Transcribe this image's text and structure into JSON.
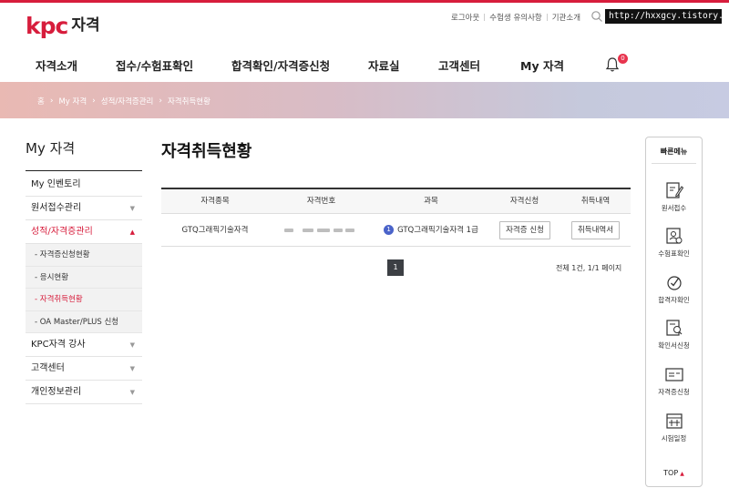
{
  "header": {
    "logo_mark": "kpc",
    "logo_text": "자격",
    "util_links": [
      "로그아웃",
      "수험생 유의사항",
      "기관소개"
    ],
    "url_overlay": "http://hxxgcy.tistory.com",
    "notification_count": "0",
    "nav": [
      "자격소개",
      "접수/수험표확인",
      "합격확인/자격증신청",
      "자료실",
      "고객센터",
      "My 자격"
    ]
  },
  "breadcrumb": [
    "홈",
    "My 자격",
    "성적/자격증관리",
    "자격취득현황"
  ],
  "sidebar": {
    "title": "My 자격",
    "items": [
      {
        "label": "My 인벤토리"
      },
      {
        "label": "원서접수관리"
      },
      {
        "label": "성적/자격증관리"
      },
      {
        "label": "KPC자격 강사"
      },
      {
        "label": "고객센터"
      },
      {
        "label": "개인정보관리"
      }
    ],
    "sub_items": [
      "- 자격증신청현황",
      "- 응시현황",
      "- 자격취득현황",
      "- OA Master/PLUS 신청"
    ]
  },
  "main": {
    "title": "자격취득현황",
    "columns": [
      "자격종목",
      "자격번호",
      "과목",
      "자격신청",
      "취득내역"
    ],
    "rows": [
      {
        "category": "GTQ그래픽기술자격",
        "subject_badge": "1",
        "subject": "GTQ그래픽기술자격 1급",
        "apply_button": "자격증 신청",
        "history_button": "취득내역서"
      }
    ],
    "page_current": "1",
    "total": "전체 1건, 1/1 페이지"
  },
  "quick_menu": {
    "title": "빠른메뉴",
    "items": [
      "원서접수",
      "수험표확인",
      "합격자확인",
      "확인서신청",
      "자격증신청",
      "시험일정"
    ],
    "top_label": "TOP"
  },
  "colors": {
    "brand": "#d71d3c",
    "badge_blue": "#4a63c9"
  }
}
